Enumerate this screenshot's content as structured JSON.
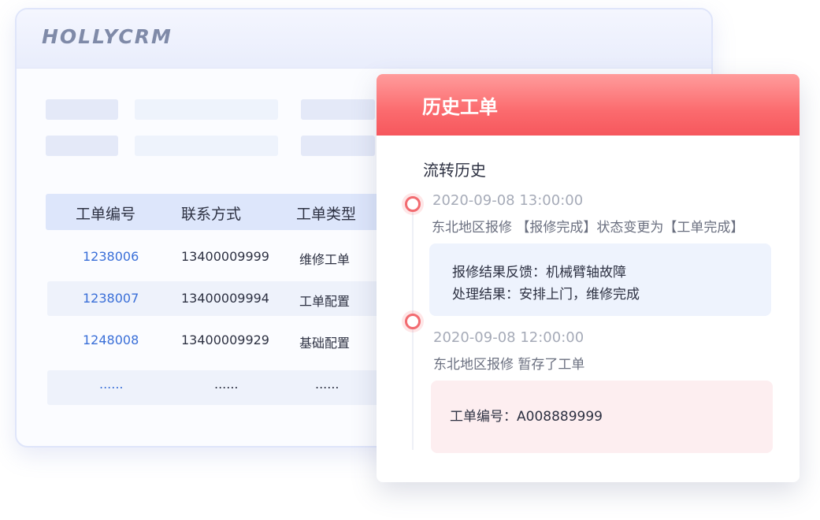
{
  "crm": {
    "logo": "HOLLYCRM",
    "table": {
      "columns": [
        "工单编号",
        "联系方式",
        "工单类型"
      ],
      "rows": [
        {
          "id": "1238006",
          "phone": "13400009999",
          "type": "维修工单"
        },
        {
          "id": "1238007",
          "phone": "13400009994",
          "type": "工单配置"
        },
        {
          "id": "1248008",
          "phone": "13400009929",
          "type": "基础配置"
        },
        {
          "id": "......",
          "phone": "......",
          "type": "......"
        }
      ]
    }
  },
  "history": {
    "title": "历史工单",
    "flow_title": "流转历史",
    "entries": [
      {
        "time": "2020-09-08 13:00:00",
        "desc": "东北地区报修 【报修完成】状态变更为【工单完成】",
        "details": [
          "报修结果反馈：机械臂轴故障",
          "处理结果：安排上门，维修完成"
        ]
      },
      {
        "time": "2020-09-08 12:00:00",
        "desc": "东北地区报修 暂存了工单",
        "details": [
          "工单编号：A008889999"
        ]
      }
    ]
  },
  "colors": {
    "accent_red": "#f6575d",
    "link_blue": "#3a6fd8",
    "table_header_bg": "#dde6fb",
    "detail_blue_bg": "#eef3fd",
    "detail_pink_bg": "#fdeef0"
  }
}
